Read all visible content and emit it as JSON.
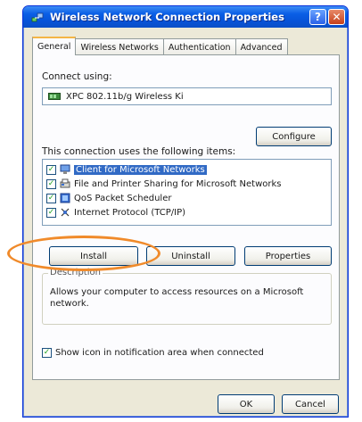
{
  "window": {
    "title": "Wireless Network Connection Properties",
    "help_label": "?",
    "close_label": "✕"
  },
  "tabs": [
    {
      "label": "General"
    },
    {
      "label": "Wireless Networks"
    },
    {
      "label": "Authentication"
    },
    {
      "label": "Advanced"
    }
  ],
  "general": {
    "connect_using_label": "Connect using:",
    "adapter_name": "XPC 802.11b/g Wireless Ki",
    "configure_label": "Configure",
    "components_label": "This connection uses the following items:",
    "items": [
      {
        "label": "Client for Microsoft Networks",
        "checked": true,
        "selected": true,
        "icon": "network-client-icon"
      },
      {
        "label": "File and Printer Sharing for Microsoft Networks",
        "checked": true,
        "selected": false,
        "icon": "file-printer-sharing-icon"
      },
      {
        "label": "QoS Packet Scheduler",
        "checked": true,
        "selected": false,
        "icon": "qos-scheduler-icon"
      },
      {
        "label": "Internet Protocol (TCP/IP)",
        "checked": true,
        "selected": false,
        "icon": "protocol-icon"
      }
    ],
    "install_label": "Install",
    "uninstall_label": "Uninstall",
    "properties_label": "Properties",
    "description_legend": "Description",
    "description_text": "Allows your computer to access resources on a Microsoft network.",
    "show_icon_label": "Show icon in notification area when connected",
    "show_icon_checked": true
  },
  "footer": {
    "ok_label": "OK",
    "cancel_label": "Cancel"
  },
  "colors": {
    "highlight_ring": "#f08a2a",
    "selection": "#316ac5",
    "titlebar": "#0753d8"
  }
}
